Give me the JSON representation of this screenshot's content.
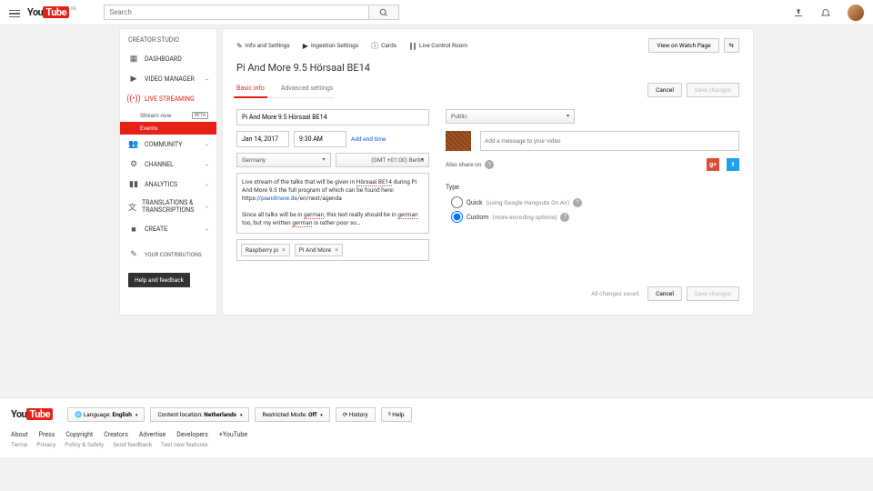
{
  "topbar": {
    "search_placeholder": "Search",
    "locale_badge": "NL"
  },
  "sidebar": {
    "title": "CREATOR STUDIO",
    "items": [
      {
        "label": "DASHBOARD"
      },
      {
        "label": "VIDEO MANAGER"
      },
      {
        "label": "LIVE STREAMING"
      },
      {
        "label": "COMMUNITY"
      },
      {
        "label": "CHANNEL"
      },
      {
        "label": "ANALYTICS"
      },
      {
        "label": "TRANSLATIONS & TRANSCRIPTIONS"
      },
      {
        "label": "CREATE"
      }
    ],
    "live_sub": {
      "stream_now": "Stream now",
      "beta": "BETA",
      "events": "Events"
    },
    "contrib": "YOUR CONTRIBUTIONS",
    "help": "Help and feedback"
  },
  "toolbar": {
    "info": "Info and Settings",
    "ingestion": "Ingestion Settings",
    "cards": "Cards",
    "live_control": "Live Control Room",
    "view_watch": "View on Watch Page"
  },
  "page": {
    "title": "Pi And More 9.5 Hörsaal BE14"
  },
  "tabs": {
    "basic": "Basic info",
    "advanced": "Advanced settings"
  },
  "form": {
    "title_value": "Pi And More 9.5 Hörsaal BE14",
    "date": "Jan 14, 2017",
    "time": "9:30 AM",
    "add_end": "Add end time",
    "country": "Germany",
    "timezone": "(GMT +01:00) Berlin",
    "description": "Live stream of the talks that will be given in Hörsaal BE14 during Pi And More 9.5 the full program of which can be found here: https://piandmore.de/en/next/agenda\n\nSince all talks will be in german, this text really should be in german too, but my written german is rather poor so…",
    "tags": [
      "Raspberry pi",
      "Pi And More"
    ],
    "privacy": "Public",
    "message_placeholder": "Add a message to your video",
    "share_label": "Also share on",
    "type_label": "Type",
    "type_quick": "Quick",
    "type_quick_paren": "(using Google Hangouts On Air)",
    "type_custom": "Custom",
    "type_custom_paren": "(more encoding options)"
  },
  "actions": {
    "saved": "All changes saved.",
    "cancel": "Cancel",
    "save": "Save changes"
  },
  "footer": {
    "lang_label": "Language:",
    "lang": "English",
    "loc_label": "Content location:",
    "loc": "Netherlands",
    "rm_label": "Restricted Mode:",
    "rm": "Off",
    "history": "History",
    "help": "Help",
    "links": [
      "About",
      "Press",
      "Copyright",
      "Creators",
      "Advertise",
      "Developers",
      "+YouTube"
    ],
    "links2": [
      "Terms",
      "Privacy",
      "Policy & Safety",
      "Send feedback",
      "Test new features"
    ]
  }
}
